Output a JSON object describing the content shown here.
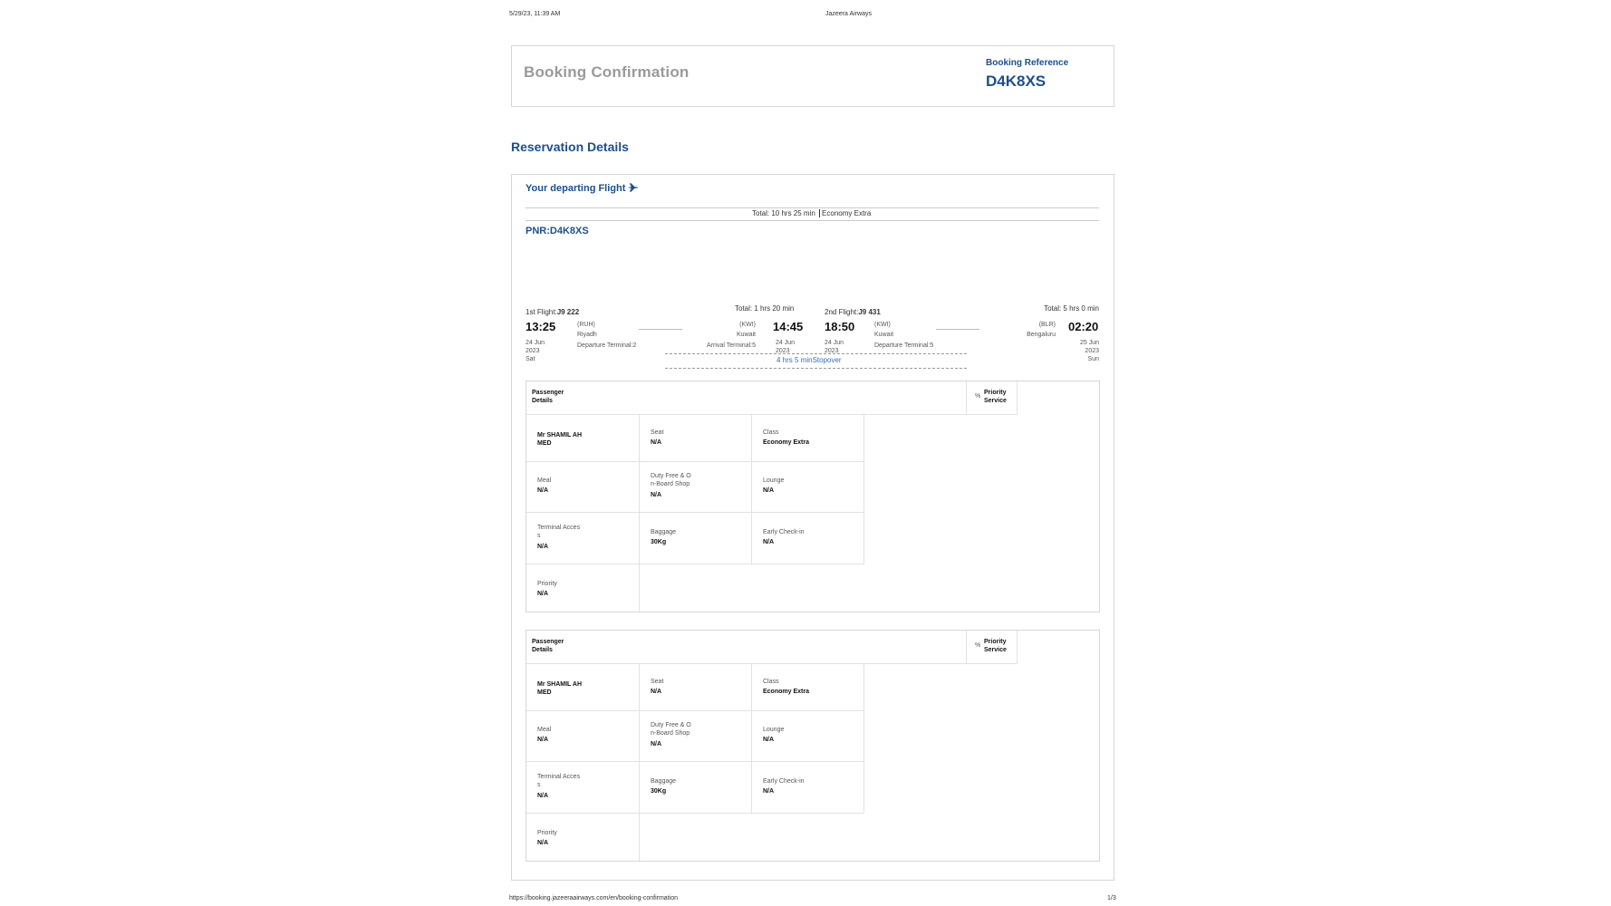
{
  "page_header": {
    "datetime": "5/29/23, 11:39 AM",
    "site": "Jazeera Airways"
  },
  "header_box": {
    "title": "Booking Confirmation",
    "ref_label": "Booking Reference",
    "ref_value": "D4K8XS"
  },
  "section_title": "Reservation Details",
  "departing": {
    "label": "Your departing Flight",
    "icon": "plane-icon",
    "total_bar": "Total: 10 hrs 25 min",
    "class_bar": "Economy Extra",
    "pnr": "PNR:D4K8XS"
  },
  "flight1": {
    "label": "1st Flight:",
    "number": "J9 222",
    "total": "Total: 1 hrs 20 min",
    "dep_time": "13:25",
    "dep_date": "24 Jun\n2023\nSat",
    "dep_code": "(RUH)",
    "dep_city": "Riyadh",
    "dep_terminal": "Departure Terminal:2",
    "arr_code": "(KWI)",
    "arr_city": "Kuwait",
    "arr_terminal": "Arrival Terminal:5",
    "arr_time": "14:45",
    "arr_date": "24 Jun\n2023"
  },
  "flight2": {
    "label": "2nd Flight:",
    "number": "J9 431",
    "total": "Total: 5 hrs 0 min",
    "dep_time": "18:50",
    "dep_date": "24 Jun\n2023",
    "dep_code": "(KWI)",
    "dep_city": "Kuwait",
    "dep_terminal": "Departure Terminal:5",
    "arr_code": "(BLR)",
    "arr_city": "Bengaluru",
    "arr_time": "02:20",
    "arr_date": "25 Jun\n2023\nSun"
  },
  "stopover": "4 hrs 5 minStopover",
  "passenger_tables": [
    {
      "header_left": "Passenger\nDetails",
      "header_right": "Priority\nService",
      "header_icon": "%",
      "name": "Mr SHAMIL AH\nMED",
      "seat_l": "Seat",
      "seat_v": "N/A",
      "class_l": "Class",
      "class_v": "Economy Extra",
      "meal_l": "Meal",
      "meal_v": "N/A",
      "duty_l": "Duty Free & O\nn-Board Shop",
      "duty_v": "N/A",
      "lounge_l": "Lounge",
      "lounge_v": "N/A",
      "term_l": "Terminal Acces\ns",
      "term_v": "N/A",
      "bag_l": "Baggage",
      "bag_v": "30Kg",
      "early_l": "Early Check-in",
      "early_v": "N/A",
      "prio_l": "Priority",
      "prio_v": "N/A"
    },
    {
      "header_left": "Passenger\nDetails",
      "header_right": "Priority\nService",
      "header_icon": "%",
      "name": "Mr SHAMIL AH\nMED",
      "seat_l": "Seat",
      "seat_v": "N/A",
      "class_l": "Class",
      "class_v": "Economy Extra",
      "meal_l": "Meal",
      "meal_v": "N/A",
      "duty_l": "Duty Free & O\nn-Board Shop",
      "duty_v": "N/A",
      "lounge_l": "Lounge",
      "lounge_v": "N/A",
      "term_l": "Terminal Acces\ns",
      "term_v": "N/A",
      "bag_l": "Baggage",
      "bag_v": "30Kg",
      "early_l": "Early Check-in",
      "early_v": "N/A",
      "prio_l": "Priority",
      "prio_v": "N/A"
    }
  ],
  "page_footer": {
    "url": "https://booking.jazeeraairways.com/en/booking-confirmation",
    "page": "1/3"
  }
}
